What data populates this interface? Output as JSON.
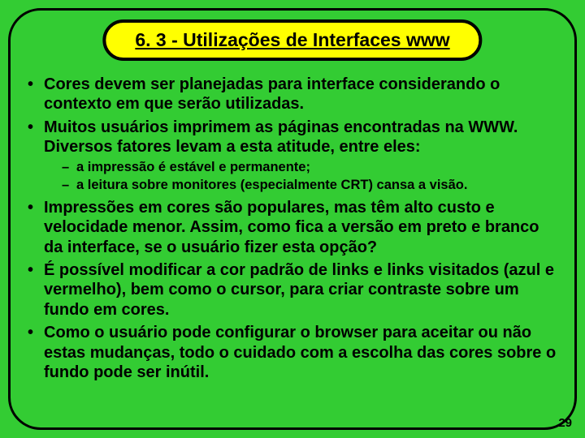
{
  "title": "6. 3 - Utilizações de Interfaces www",
  "bullets": [
    {
      "text": "Cores devem ser planejadas para interface considerando o contexto em que serão utilizadas."
    },
    {
      "text": "Muitos usuários imprimem as páginas encontradas na WWW. Diversos fatores levam a esta atitude, entre eles:",
      "sub": [
        "a impressão é estável e permanente;",
        "a leitura sobre monitores (especialmente CRT) cansa a visão."
      ]
    },
    {
      "text": "Impressões em cores são populares, mas têm alto custo e velocidade menor. Assim, como fica a versão em preto e branco da interface, se o usuário fizer esta opção?"
    },
    {
      "text": "É possível modificar a cor padrão de links e links visitados (azul e vermelho), bem como o cursor, para criar contraste sobre um fundo em cores."
    },
    {
      "text": "Como o usuário pode configurar o browser para aceitar ou não estas mudanças, todo o cuidado com a escolha das cores sobre o fundo pode ser inútil."
    }
  ],
  "page_number": "29"
}
